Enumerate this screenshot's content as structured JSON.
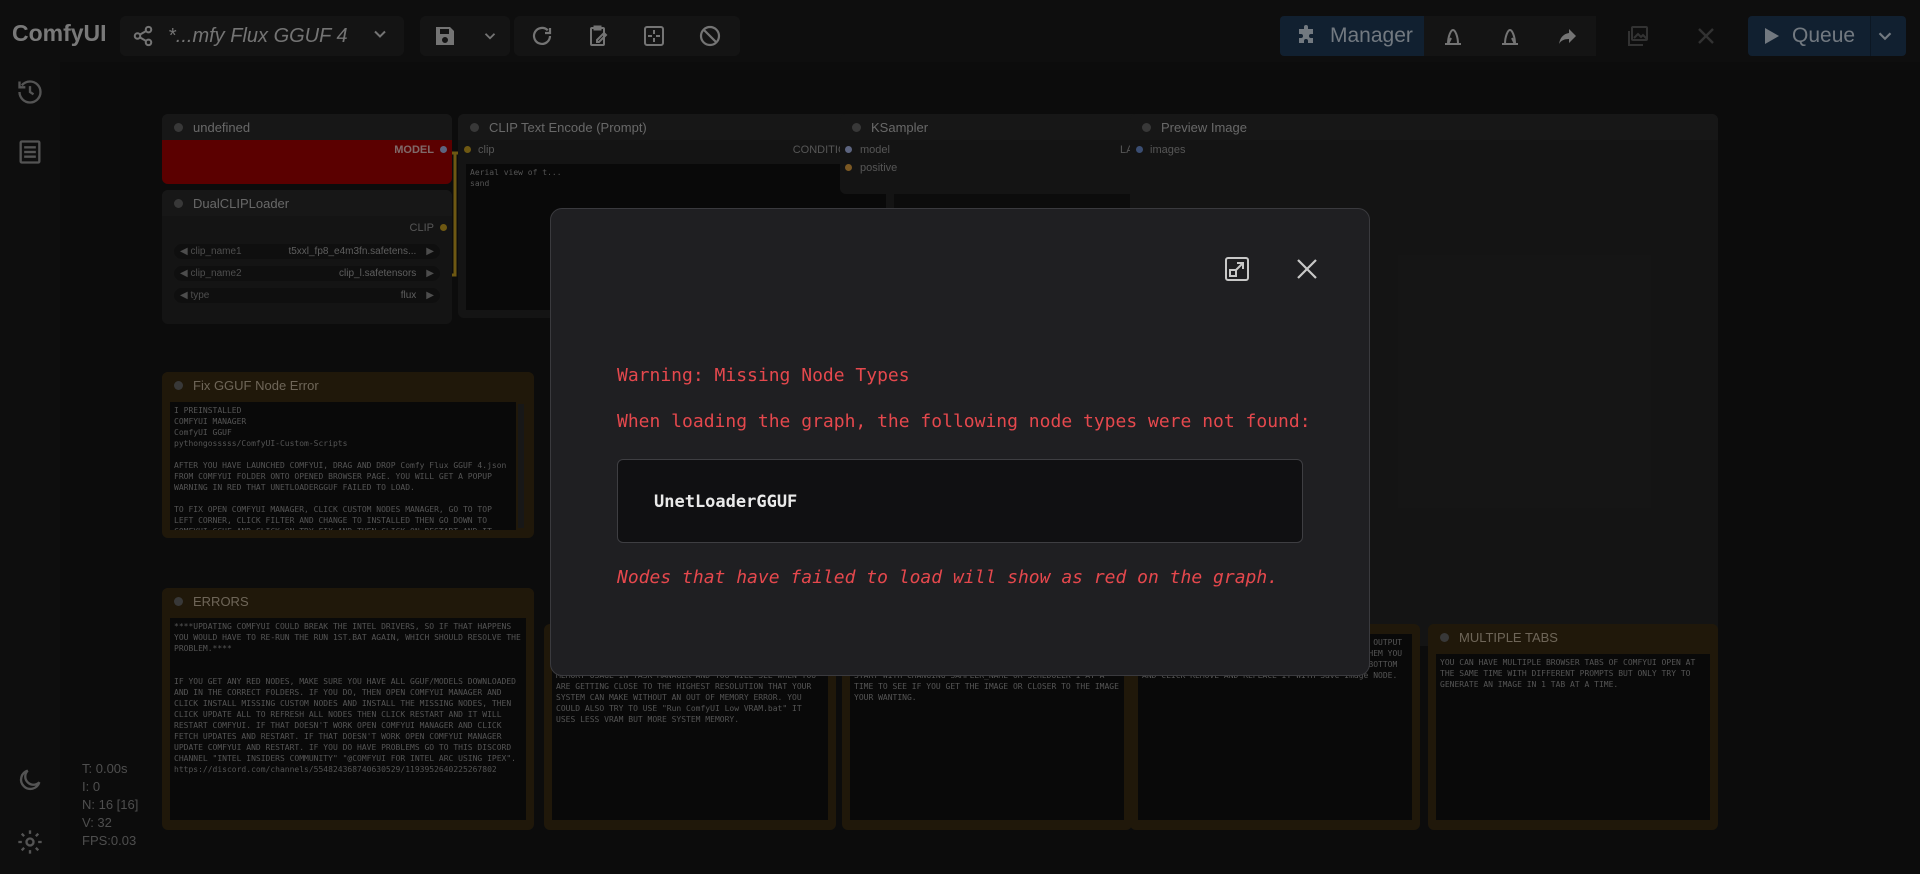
{
  "app": {
    "title": "ComfyUI"
  },
  "workflow": {
    "name": "*...mfy Flux GGUF 4"
  },
  "toolbar": {
    "manager_label": "Manager",
    "queue_label": "Queue"
  },
  "nodes": {
    "unet": {
      "title": "undefined",
      "output": "MODEL"
    },
    "dualclip": {
      "title": "DualCLIPLoader",
      "output": "CLIP",
      "widgets": [
        {
          "label": "clip_name1",
          "value": "t5xxl_fp8_e4m3fn.safetens..."
        },
        {
          "label": "clip_name2",
          "value": "clip_l.safetensors"
        },
        {
          "label": "type",
          "value": "flux"
        }
      ]
    },
    "clip_text": {
      "title": "CLIP Text Encode (Prompt)",
      "input": "clip",
      "output": "CONDITIONING",
      "text": "Aerial view of t...\nsand"
    },
    "ksampler": {
      "title": "KSampler",
      "input1": "model",
      "input2": "positive",
      "output": "LATENT"
    },
    "preview": {
      "title": "Preview Image",
      "input": "images"
    },
    "fix_gguf": {
      "title": "Fix GGUF Node Error",
      "text": "I PREINSTALLED\nCOMFYUI MANAGER\nComfyUI GGUF\npythongosssss/ComfyUI-Custom-Scripts\n\nAFTER YOU HAVE LAUNCHED COMFYUI, DRAG AND DROP Comfy Flux GGUF 4.json FROM COMFYUI FOLDER ONTO OPENED BROWSER PAGE. YOU WILL GET A POPUP WARNING IN RED THAT UNETLOADERGGUF FAILED TO LOAD.\n\nTO FIX OPEN COMFYUI MANAGER, CLICK CUSTOM NODES MANAGER, GO TO TOP LEFT CORNER, CLICK FILTER AND CHANGE TO INSTALLED THEN GO DOWN TO COMFYUI-GGUF AND CLICK ON TRY FIX AND THEN CLICK ON RESTART AND IT WILL RESTART COMFYUI AND YOU WILL BE GOOD TO START USING COMFYUI."
    },
    "errors": {
      "title": "ERRORS",
      "text": "****UPDATING COMFYUI COULD BREAK THE INTEL DRIVERS, SO IF THAT HAPPENS YOU WOULD HAVE TO RE-RUN THE RUN 1ST.BAT AGAIN, WHICH SHOULD RESOLVE THE PROBLEM.****\n\n\nIF YOU GET ANY RED NODES, MAKE SURE YOU HAVE ALL GGUF/MODELS DOWNLOADED AND IN THE CORRECT FOLDERS. IF YOU DO, THEN OPEN COMFYUI MANAGER AND CLICK INSTALL MISSING CUSTOM NODES AND INSTALL THE MISSING NODES, THEN CLICK UPDATE ALL TO REFRESH ALL NODES THEN CLICK RESTART AND IT WILL RESTART COMFYUI. IF THAT DOESN'T WORK OPEN COMFYUI MANAGER AND CLICK FETCH UPDATES AND RESTART. IF THAT DOESN'T WORK OPEN COMFYUI MANAGER UPDATE COMFYUI AND RESTART. IF YOU DO HAVE PROBLEMS GO TO THIS DISCORD CHANNEL \"INTEL INSIDERS COMMUNITY\" \"@COMFYUI FOR INTEL ARC USING IPEX\".\nhttps://discord.com/channels/554824368740630529/1193952640225267802"
    },
    "note2": {
      "text": "SLOWLY INCREASE RESOLUTION UNTIL YOU FIND THE HIGHEST RESOLUTION THAT YOUR SYSTEM WILL GENERATE WITHOUT GETTING AN OUT OF MEMORY ERROR. KEEP AN EYE YOUR GPU MEMORY USAGE IN TASK MANAGER AND YOU WILL SEE WHEN YOU ARE GETTING CLOSE TO THE HIGHEST RESOLUTION THAT YOUR SYSTEM CAN MAKE WITHOUT AN OUT OF MEMORY ERROR. YOU COULD ALSO TRY TO USE \"Run ComfyUI Low VRAM.bat\" IT USES LESS VRAM BUT MORE SYSTEM MEMORY."
    },
    "note3": {
      "text": "HIGHER BUT THIS GGUF MODEL WAS MADE FOR 4 STEPS. YOU CAN CHANGE SAMPLER_NAME FOR DIFFERENT IMAGES. YOU CAN ALSO CHANGE SCHEDULER FOR DIFFERENT IMAGES.\nSTART WITH CHANGING SAMPLER_NAME OR SCHEDULER 1 AT A TIME TO SEE IF YOU GET THE IMAGE OR CLOSER TO THE IMAGE YOUR WANTING."
    },
    "note4": {
      "text": "THE IMAGE AND NOT TO SAVE ALL THE IMAGES TO THE OUTPUT FOLDER IN ComfyUI\\output. IF YOU WANT TO SAVE THEM YOU CAN RIGHT CLICK ON PreviewImage NODE GO TO THE BOTTOM AND CLICK REMOVE AND REPLACE IT WITH Save Image NODE."
    },
    "multiple_tabs": {
      "title": "MULTIPLE TABS",
      "text": "YOU CAN HAVE MULTIPLE BROWSER TABS OF COMFYUI OPEN AT THE SAME TIME WITH DIFFERENT PROMPTS BUT ONLY TRY TO GENERATE AN IMAGE IN 1 TAB AT A TIME."
    }
  },
  "stats": {
    "t": "T: 0.00s",
    "i": "I: 0",
    "n": "N: 16 [16]",
    "v": "V: 32",
    "fps": "FPS:0.03"
  },
  "dialog": {
    "title": "Warning: Missing Node Types",
    "description": "When loading the graph, the following node types were not found:",
    "missing_nodes": [
      "UnetLoaderGGUF"
    ],
    "footer": "Nodes that have failed to load will show as red on the graph."
  },
  "colors": {
    "accent": "#1f3b58",
    "error": "#e5484d",
    "missing_node": "#8b0000"
  }
}
